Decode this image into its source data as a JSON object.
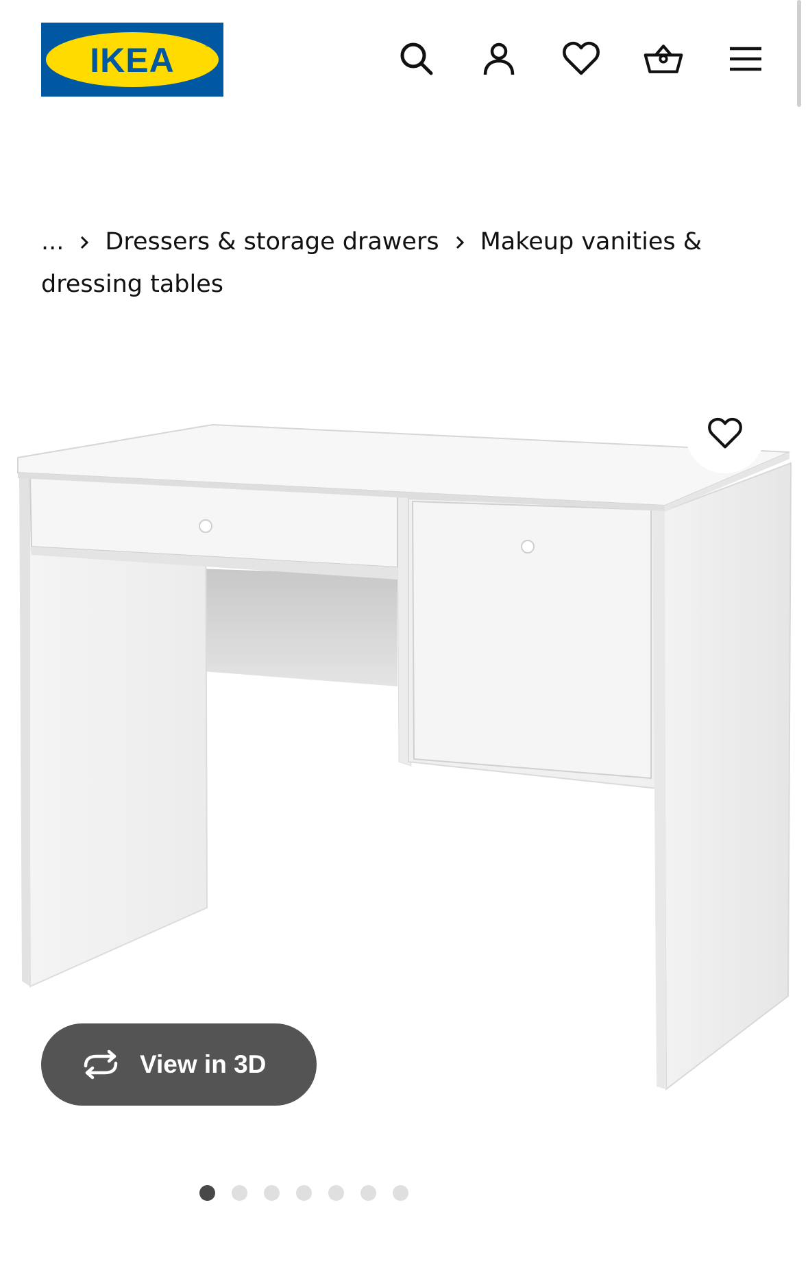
{
  "brand": {
    "logo_text": "IKEA",
    "colors": {
      "blue": "#0058a3",
      "yellow": "#ffdb00"
    }
  },
  "header": {
    "icons": [
      "search-icon",
      "account-icon",
      "heart-icon",
      "basket-icon",
      "menu-icon"
    ]
  },
  "breadcrumb": {
    "ellipsis": "...",
    "items": [
      "Dressers & storage drawers",
      "Makeup vanities & dressing tables"
    ]
  },
  "gallery": {
    "view3d_label": "View in 3D",
    "slide_count": 7,
    "active_slide": 1
  },
  "colors": {
    "view3d_bg": "#545454",
    "dot_active": "#484848",
    "dot_inactive": "#dfdfdf"
  }
}
